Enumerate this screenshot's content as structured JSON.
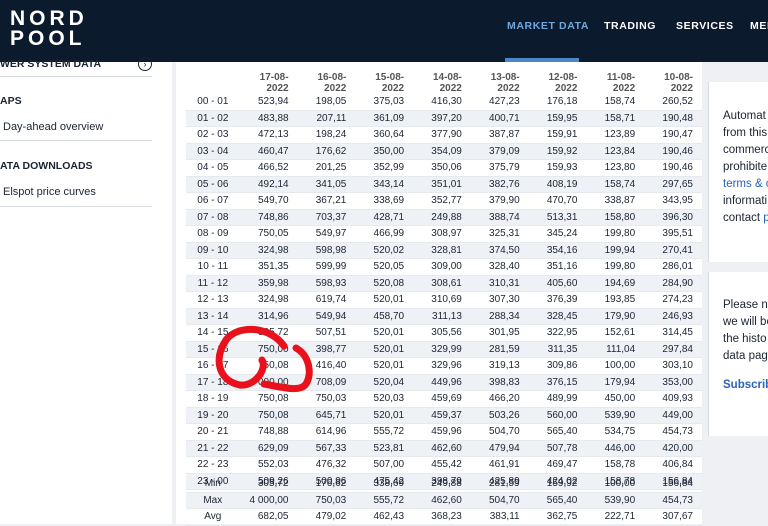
{
  "header": {
    "logo_line1": "NORD",
    "logo_line2": "POOL",
    "nav": [
      "MARKET DATA",
      "TRADING",
      "SERVICES",
      "MED"
    ]
  },
  "sidebar": {
    "section1": "WER SYSTEM DATA",
    "section2": "APS",
    "link1": "Day-ahead overview",
    "section3": "ATA DOWNLOADS",
    "link2": "Elspot price curves"
  },
  "table": {
    "dates": [
      "17-08-2022",
      "16-08-2022",
      "15-08-2022",
      "14-08-2022",
      "13-08-2022",
      "12-08-2022",
      "11-08-2022",
      "10-08-2022"
    ],
    "rows": [
      {
        "h": "00 - 01",
        "v": [
          "523,94",
          "198,05",
          "375,03",
          "416,30",
          "427,23",
          "176,18",
          "158,74",
          "260,52"
        ]
      },
      {
        "h": "01 - 02",
        "v": [
          "483,88",
          "207,11",
          "361,09",
          "397,20",
          "400,71",
          "159,95",
          "158,71",
          "190,48"
        ]
      },
      {
        "h": "02 - 03",
        "v": [
          "472,13",
          "198,24",
          "360,64",
          "377,90",
          "387,87",
          "159,91",
          "123,89",
          "190,47"
        ]
      },
      {
        "h": "03 - 04",
        "v": [
          "460,47",
          "176,62",
          "350,00",
          "354,09",
          "379,09",
          "159,92",
          "123,84",
          "190,46"
        ]
      },
      {
        "h": "04 - 05",
        "v": [
          "466,52",
          "201,25",
          "352,99",
          "350,06",
          "375,79",
          "159,93",
          "123,80",
          "190,46"
        ]
      },
      {
        "h": "05 - 06",
        "v": [
          "492,14",
          "341,05",
          "343,14",
          "351,01",
          "382,76",
          "408,19",
          "158,74",
          "297,65"
        ]
      },
      {
        "h": "06 - 07",
        "v": [
          "549,70",
          "367,21",
          "338,69",
          "352,77",
          "379,90",
          "470,70",
          "338,87",
          "343,95"
        ]
      },
      {
        "h": "07 - 08",
        "v": [
          "748,86",
          "703,37",
          "428,71",
          "249,88",
          "388,74",
          "513,31",
          "158,80",
          "396,30"
        ]
      },
      {
        "h": "08 - 09",
        "v": [
          "750,05",
          "549,97",
          "466,99",
          "308,97",
          "325,31",
          "345,24",
          "199,80",
          "395,51"
        ]
      },
      {
        "h": "09 - 10",
        "v": [
          "324,98",
          "598,98",
          "520,02",
          "328,81",
          "374,50",
          "354,16",
          "199,94",
          "270,41"
        ]
      },
      {
        "h": "10 - 11",
        "v": [
          "351,35",
          "599,99",
          "520,05",
          "309,00",
          "328,40",
          "351,16",
          "199,80",
          "286,01"
        ]
      },
      {
        "h": "11 - 12",
        "v": [
          "359,98",
          "598,93",
          "520,08",
          "308,61",
          "310,31",
          "405,60",
          "194,69",
          "284,90"
        ]
      },
      {
        "h": "12 - 13",
        "v": [
          "324,98",
          "619,74",
          "520,01",
          "310,69",
          "307,30",
          "376,39",
          "193,85",
          "274,23"
        ]
      },
      {
        "h": "13 - 14",
        "v": [
          "314,96",
          "549,94",
          "458,70",
          "311,13",
          "288,34",
          "328,45",
          "179,90",
          "246,93"
        ]
      },
      {
        "h": "14 - 15",
        "v": [
          "305,72",
          "507,51",
          "520,01",
          "305,56",
          "301,95",
          "322,95",
          "152,61",
          "314,45"
        ]
      },
      {
        "h": "15 - 16",
        "v": [
          "750,00",
          "398,77",
          "520,01",
          "329,99",
          "281,59",
          "311,35",
          "111,04",
          "297,84"
        ]
      },
      {
        "h": "16 - 17",
        "v": [
          "750,08",
          "416,40",
          "520,01",
          "329,96",
          "319,13",
          "309,86",
          "100,00",
          "303,10"
        ]
      },
      {
        "h": "17 - 18",
        "v": [
          "4 000,00",
          "708,09",
          "520,04",
          "449,96",
          "398,83",
          "376,15",
          "179,94",
          "353,00"
        ]
      },
      {
        "h": "18 - 19",
        "v": [
          "750,08",
          "750,03",
          "520,03",
          "459,69",
          "466,20",
          "489,99",
          "450,00",
          "409,93"
        ]
      },
      {
        "h": "19 - 20",
        "v": [
          "750,08",
          "645,71",
          "520,01",
          "459,37",
          "503,26",
          "560,00",
          "539,90",
          "449,00"
        ]
      },
      {
        "h": "20 - 21",
        "v": [
          "748,88",
          "614,96",
          "555,72",
          "459,96",
          "504,70",
          "565,40",
          "534,75",
          "454,73"
        ]
      },
      {
        "h": "21 - 22",
        "v": [
          "629,09",
          "567,33",
          "523,81",
          "462,60",
          "479,94",
          "507,78",
          "446,00",
          "420,00"
        ]
      },
      {
        "h": "22 - 23",
        "v": [
          "552,03",
          "476,32",
          "507,00",
          "455,42",
          "461,91",
          "469,47",
          "158,78",
          "406,84"
        ]
      },
      {
        "h": "23 - 00",
        "v": [
          "509,26",
          "500,96",
          "475,42",
          "398,79",
          "425,89",
          "424,02",
          "158,78",
          "156,84"
        ]
      }
    ],
    "summary": [
      {
        "h": "Min",
        "v": [
          "305,72",
          "176,62",
          "338,69",
          "249,88",
          "281,59",
          "159,92",
          "100,00",
          "156,84"
        ]
      },
      {
        "h": "Max",
        "v": [
          "4 000,00",
          "750,03",
          "555,72",
          "462,60",
          "504,70",
          "565,40",
          "539,90",
          "454,73"
        ]
      },
      {
        "h": "Avg",
        "v": [
          "682,05",
          "479,02",
          "462,43",
          "368,23",
          "383,11",
          "362,75",
          "222,71",
          "307,67"
        ]
      }
    ]
  },
  "right_panel": {
    "lines1": [
      "Automat",
      "from this",
      "commerc",
      "prohibite"
    ],
    "link_a": "terms & c",
    "lines1b": [
      "informati"
    ],
    "contact": "contact ",
    "contact_link": "p",
    "lines2": [
      "Please no",
      "we will be",
      "the histo",
      "data pag"
    ],
    "subscribe": "Subscrib"
  },
  "annotation": {
    "color": "#e8111c"
  }
}
